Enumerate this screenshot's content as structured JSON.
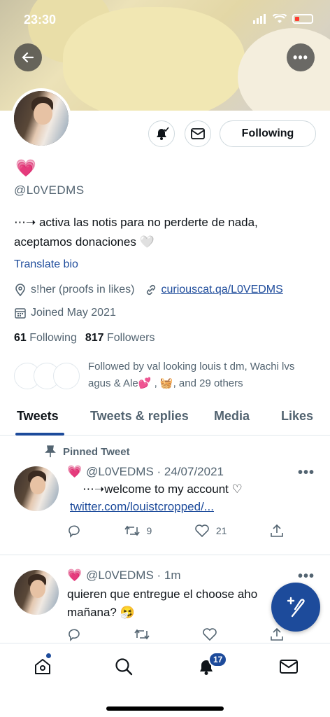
{
  "status_bar": {
    "time": "23:30"
  },
  "profile": {
    "display_name": "💗",
    "handle": "@L0VEDMS",
    "bio_line1": "⋯➝ activa las notis para no perderte de nada,",
    "bio_line2": "aceptamos donaciones 🤍",
    "translate_label": "Translate bio",
    "location": "s!her (proofs in likes)",
    "website": "curiouscat.qa/L0VEDMS",
    "joined": "Joined May 2021",
    "following_count": "61",
    "following_label": "Following",
    "followers_count": "817",
    "followers_label": "Followers",
    "followed_by_line1": "Followed by val looking louis t dm, Wachi lvs",
    "followed_by_line2": "agus & Ale💕 , 🧺, and 29 others",
    "follow_button_label": "Following"
  },
  "tabs": [
    {
      "label": "Tweets"
    },
    {
      "label": "Tweets & replies"
    },
    {
      "label": "Media"
    },
    {
      "label": "Likes"
    }
  ],
  "tweets": [
    {
      "pinned_label": "Pinned Tweet",
      "name": "💗",
      "handle_time": "@L0VEDMS · 24/07/2021",
      "text": "⋯➝welcome to my account ♡",
      "link": "twitter.com/louistcropped/...",
      "retweets": "9",
      "likes": "21"
    },
    {
      "name": "💗",
      "handle_time": "@L0VEDMS · 1m",
      "text_line1": "quieren que entregue el choose aho",
      "text_line2": "mañana? 🤧"
    }
  ],
  "bottom_nav": {
    "notifications_badge": "17"
  },
  "colors": {
    "accent": "#1d4b9b",
    "muted": "#536471",
    "text": "#0f1419"
  }
}
